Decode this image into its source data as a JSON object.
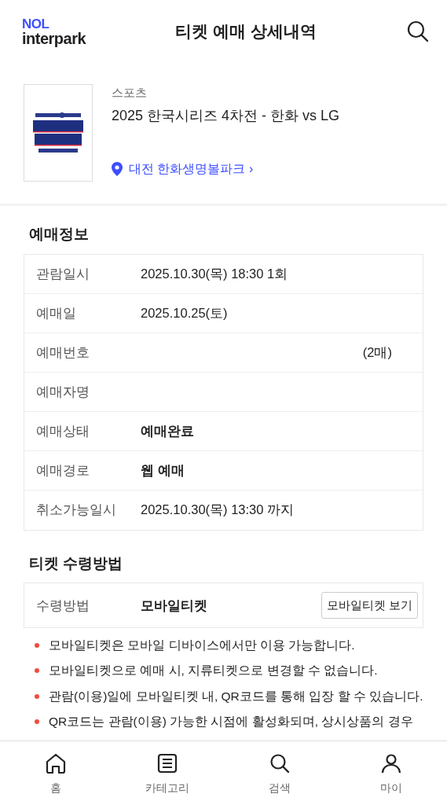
{
  "header": {
    "logo_top": "NOL",
    "logo_bottom": "interpark",
    "title": "티켓 예매 상세내역"
  },
  "product": {
    "category": "스포츠",
    "title": "2025 한국시리즈 4차전 - 한화 vs LG",
    "venue": "대전 한화생명볼파크",
    "venue_arrow": "›"
  },
  "booking_info": {
    "heading": "예매정보",
    "rows": [
      {
        "label": "관람일시",
        "value": "2025.10.30(목) 18:30 1회"
      },
      {
        "label": "예매일",
        "value": "2025.10.25(토)"
      },
      {
        "label": "예매번호",
        "value_extra": "(2매)"
      },
      {
        "label": "예매자명"
      },
      {
        "label": "예매상태",
        "value": "예매완료",
        "bold": true
      },
      {
        "label": "예매경로",
        "value": "웹 예매",
        "bold": true
      },
      {
        "label": "취소가능일시",
        "value": "2025.10.30(목) 13:30 까지"
      }
    ]
  },
  "delivery": {
    "heading": "티켓 수령방법",
    "label": "수령방법",
    "value": "모바일티켓",
    "button": "모바일티켓 보기",
    "notes": [
      "모바일티켓은 모바일 디바이스에서만 이용 가능합니다.",
      "모바일티켓으로 예매 시, 지류티켓으로 변경할 수 없습니다.",
      "관람(이용)일에 모바일티켓 내, QR코드를 통해 입장 할 수 있습니다.",
      "QR코드는 관람(이용) 가능한 시점에 활성화되며, 상시상품의 경우"
    ]
  },
  "bottom_nav": [
    {
      "kind": "home",
      "label": "홈"
    },
    {
      "kind": "category",
      "label": "카테고리"
    },
    {
      "kind": "search",
      "label": "검색"
    },
    {
      "kind": "my",
      "label": "마이"
    }
  ]
}
